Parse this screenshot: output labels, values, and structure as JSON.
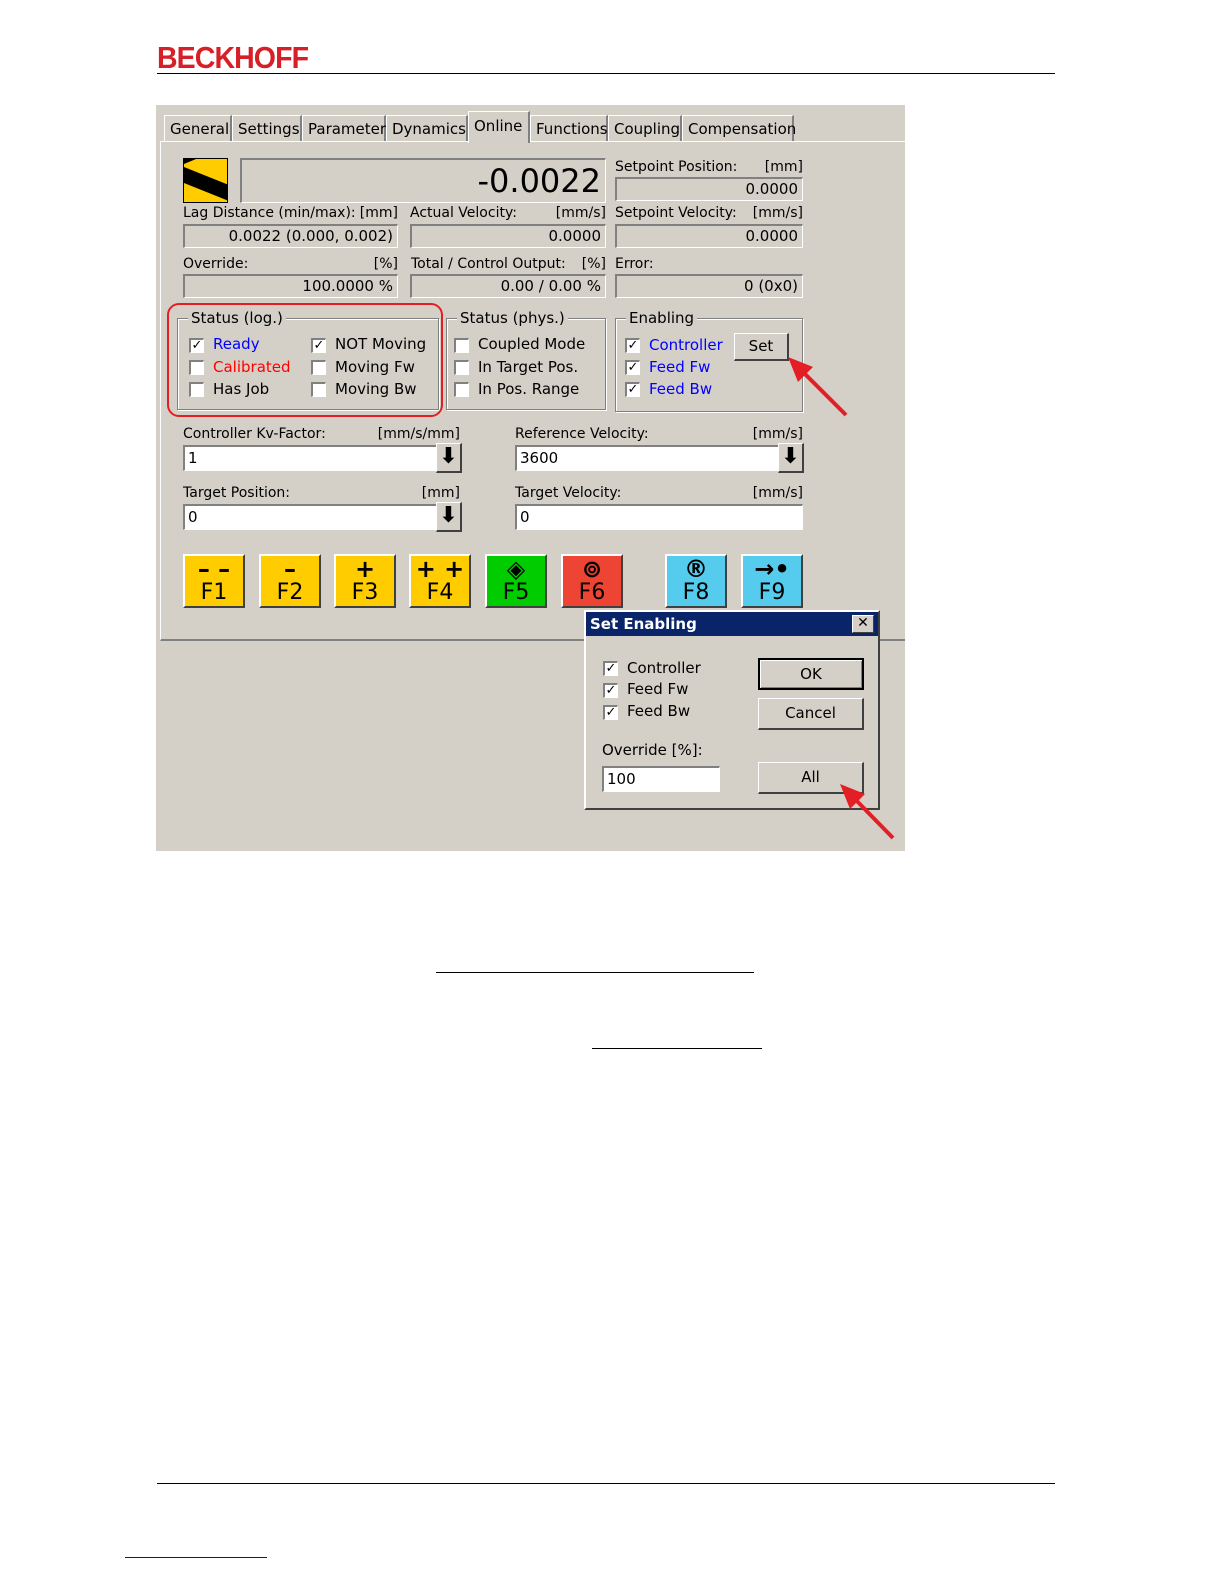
{
  "brand": {
    "logo": "BECKHOFF",
    "color": "#d61f26"
  },
  "tabs": [
    "General",
    "Settings",
    "Parameter",
    "Dynamics",
    "Online",
    "Functions",
    "Coupling",
    "Compensation"
  ],
  "active_tab": "Online",
  "online": {
    "position_value": "-0.0022",
    "setpoint_position": {
      "label": "Setpoint Position:",
      "unit": "[mm]",
      "value": "0.0000"
    },
    "lag_distance": {
      "label": "Lag Distance (min/max):",
      "unit": "[mm]",
      "value": "0.0022  (0.000, 0.002)"
    },
    "actual_velocity": {
      "label": "Actual Velocity:",
      "unit": "[mm/s]",
      "value": "0.0000"
    },
    "setpoint_velocity": {
      "label": "Setpoint Velocity:",
      "unit": "[mm/s]",
      "value": "0.0000"
    },
    "override": {
      "label": "Override:",
      "unit": "[%]",
      "value": "100.0000 %"
    },
    "total_output": {
      "label": "Total / Control Output:",
      "unit": "[%]",
      "value": "0.00 /  0.00 %"
    },
    "error": {
      "label": "Error:",
      "value": "0 (0x0)"
    }
  },
  "status_log": {
    "title": "Status (log.)",
    "items": [
      {
        "label": "Ready",
        "checked": "✓",
        "color": "#0000ff"
      },
      {
        "label": "Calibrated",
        "checked": "",
        "color": "#ff0000"
      },
      {
        "label": "Has Job",
        "checked": ""
      },
      {
        "label": "NOT Moving",
        "checked": "✓"
      },
      {
        "label": "Moving Fw",
        "checked": ""
      },
      {
        "label": "Moving Bw",
        "checked": ""
      }
    ]
  },
  "status_phys": {
    "title": "Status (phys.)",
    "items": [
      {
        "label": "Coupled Mode",
        "checked": ""
      },
      {
        "label": "In Target Pos.",
        "checked": ""
      },
      {
        "label": "In Pos. Range",
        "checked": ""
      }
    ]
  },
  "enabling": {
    "title": "Enabling",
    "set_label": "Set",
    "items": [
      {
        "label": "Controller",
        "checked": "✓",
        "color": "#0000ff"
      },
      {
        "label": "Feed Fw",
        "checked": "✓",
        "color": "#0000ff"
      },
      {
        "label": "Feed Bw",
        "checked": "✓",
        "color": "#0000ff"
      }
    ]
  },
  "inputs": {
    "kv_factor": {
      "label": "Controller Kv-Factor:",
      "unit": "[mm/s/mm]",
      "value": "1"
    },
    "ref_velocity": {
      "label": "Reference Velocity:",
      "unit": "[mm/s]",
      "value": "3600"
    },
    "target_position": {
      "label": "Target Position:",
      "unit": "[mm]",
      "value": "0"
    },
    "target_velocity": {
      "label": "Target Velocity:",
      "unit": "[mm/s]",
      "value": "0"
    }
  },
  "fkeys": [
    {
      "label": "F1",
      "symbol": "– –",
      "color": "#ffcc00"
    },
    {
      "label": "F2",
      "symbol": "–",
      "color": "#ffcc00"
    },
    {
      "label": "F3",
      "symbol": "+",
      "color": "#ffcc00"
    },
    {
      "label": "F4",
      "symbol": "+ +",
      "color": "#ffcc00"
    },
    {
      "label": "F5",
      "symbol": "◈",
      "color": "#00cc00"
    },
    {
      "label": "F6",
      "symbol": "⊚",
      "color": "#ee4433"
    },
    {
      "label": "F8",
      "symbol": "®",
      "color": "#55ccee"
    },
    {
      "label": "F9",
      "symbol": "→•",
      "color": "#55ccee"
    }
  ],
  "dialog": {
    "title": "Set Enabling",
    "close": "✕",
    "items": [
      {
        "label": "Controller",
        "checked": "✓"
      },
      {
        "label": "Feed Fw",
        "checked": "✓"
      },
      {
        "label": "Feed Bw",
        "checked": "✓"
      }
    ],
    "ok": "OK",
    "cancel": "Cancel",
    "override_label": "Override [%]:",
    "override_value": "100",
    "all": "All"
  },
  "annotation_color": "#e31e24"
}
